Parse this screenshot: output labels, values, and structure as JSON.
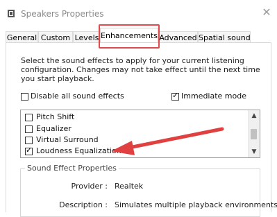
{
  "window": {
    "title": "Speakers Properties",
    "close_glyph": "✕"
  },
  "tabs": [
    {
      "label": "General",
      "active": false
    },
    {
      "label": "Custom",
      "active": false
    },
    {
      "label": "Levels",
      "active": false
    },
    {
      "label": "Enhancements",
      "active": true
    },
    {
      "label": "Advanced",
      "active": false
    },
    {
      "label": "Spatial sound",
      "active": false
    }
  ],
  "description": "Select the sound effects to apply for your current listening configuration. Changes may not take effect until the next time you start playback.",
  "options": {
    "disable_all": {
      "label": "Disable all sound effects",
      "checked": false
    },
    "immediate_mode": {
      "label": "Immediate mode",
      "checked": true
    }
  },
  "effects": [
    {
      "label": "Pitch Shift",
      "checked": false
    },
    {
      "label": "Equalizer",
      "checked": false
    },
    {
      "label": "Virtual Surround",
      "checked": false
    },
    {
      "label": "Loudness Equalization",
      "checked": true
    }
  ],
  "properties": {
    "group_title": "Sound Effect Properties",
    "provider_label": "Provider :",
    "provider_value": "Realtek",
    "description_label": "Description :",
    "description_value": "Simulates multiple playback environments."
  },
  "colors": {
    "highlight_box": "#e14a4a",
    "arrow": "#e0403f"
  }
}
